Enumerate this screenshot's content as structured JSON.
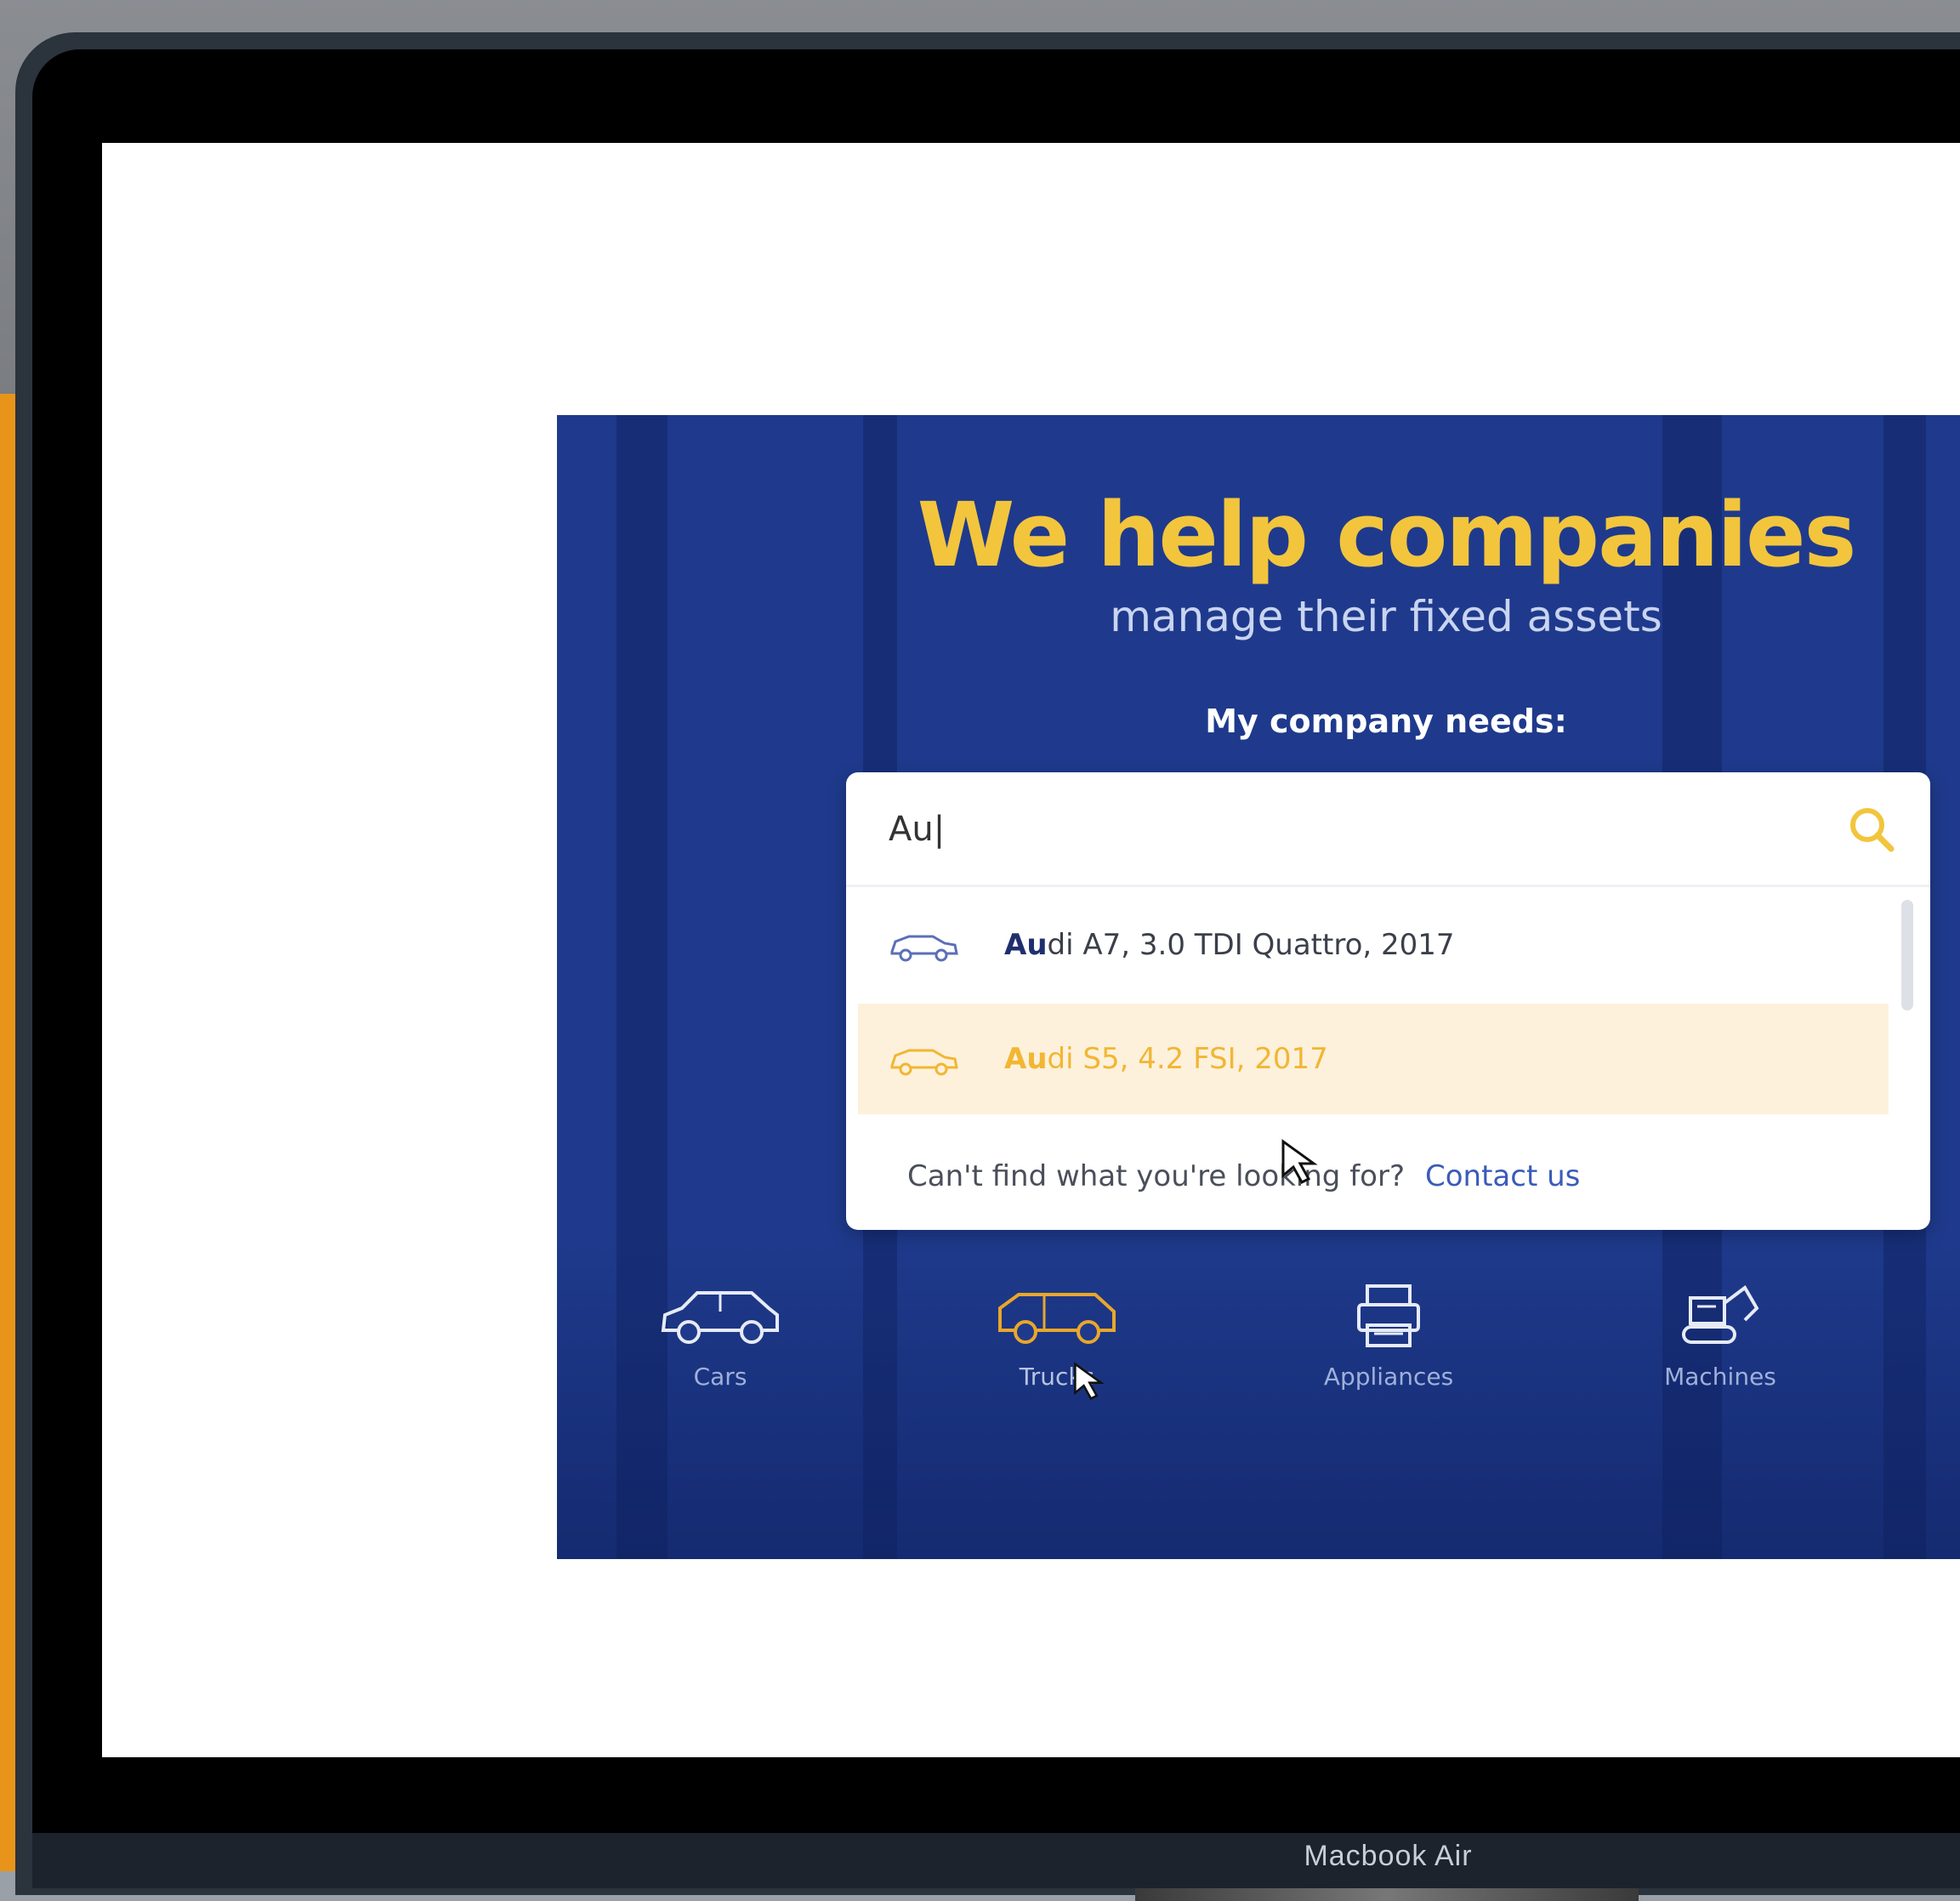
{
  "device": {
    "label": "Macbook Air"
  },
  "hero": {
    "title": "We help companies",
    "subtitle": "manage their fixed assets",
    "needs_label": "My company needs:"
  },
  "search": {
    "value": "Au|",
    "suggestions": [
      {
        "match": "Au",
        "rest": "di A7, 3.0 TDI Quattro, 2017",
        "icon": "car-icon",
        "highlighted": false
      },
      {
        "match": "Au",
        "rest": "di S5, 4.2 FSI, 2017",
        "icon": "car-icon",
        "highlighted": true
      }
    ],
    "footer_text": "Can't find what you're looking for?",
    "contact_label": "Contact us"
  },
  "categories": [
    {
      "label": "Cars",
      "icon": "car-icon"
    },
    {
      "label": "Trucks",
      "icon": "truck-icon"
    },
    {
      "label": "Appliances",
      "icon": "printer-icon"
    },
    {
      "label": "Machines",
      "icon": "excavator-icon"
    }
  ],
  "colors": {
    "brand_yellow": "#f2c53d",
    "hero_blue": "#1f3a8c",
    "highlight_row": "#fdf1dc",
    "link_blue": "#3a5bb8"
  }
}
